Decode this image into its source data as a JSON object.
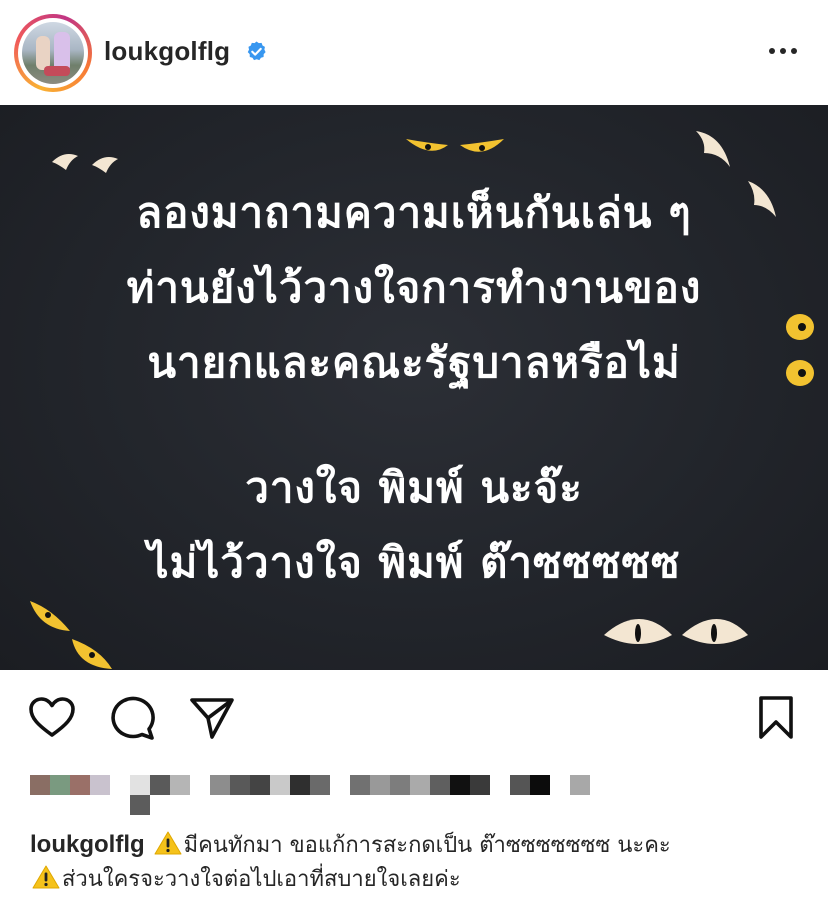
{
  "header": {
    "username": "loukgolflg",
    "verified": true,
    "avatar_icon": "profile-photo",
    "more_icon": "more-horizontal-icon"
  },
  "post": {
    "lines": [
      "ลองมาถามความเห็นกันเล่น ๆ",
      "ท่านยังไว้วางใจการทำงานของ",
      "นายกและคณะรัฐบาลหรือไม่",
      "วางใจ พิมพ์ นะจ๊ะ",
      "ไม่ไว้วางใจ พิมพ์ ต๊าซซซซซ"
    ],
    "background_color": "#22252b",
    "text_color": "#ffffff"
  },
  "actions": {
    "like_icon": "heart-icon",
    "comment_icon": "comment-bubble-icon",
    "share_icon": "paper-plane-icon",
    "save_icon": "bookmark-icon"
  },
  "caption": {
    "username": "loukgolflg",
    "line1": "มีคนทักมา ขอแก้การสะกดเป็น ต๊าซซซซซซซ นะคะ",
    "line2": "ส่วนใครจะวางใจต่อไปเอาที่สบายใจเลยค่ะ",
    "warning_icon": "warning-icon"
  },
  "colors": {
    "verified_blue": "#3897f0",
    "ring_gradient": [
      "#f9b233",
      "#f05a5a",
      "#c13584"
    ],
    "eye_yellow": "#f2c230",
    "eye_cream": "#f3e6d2"
  }
}
